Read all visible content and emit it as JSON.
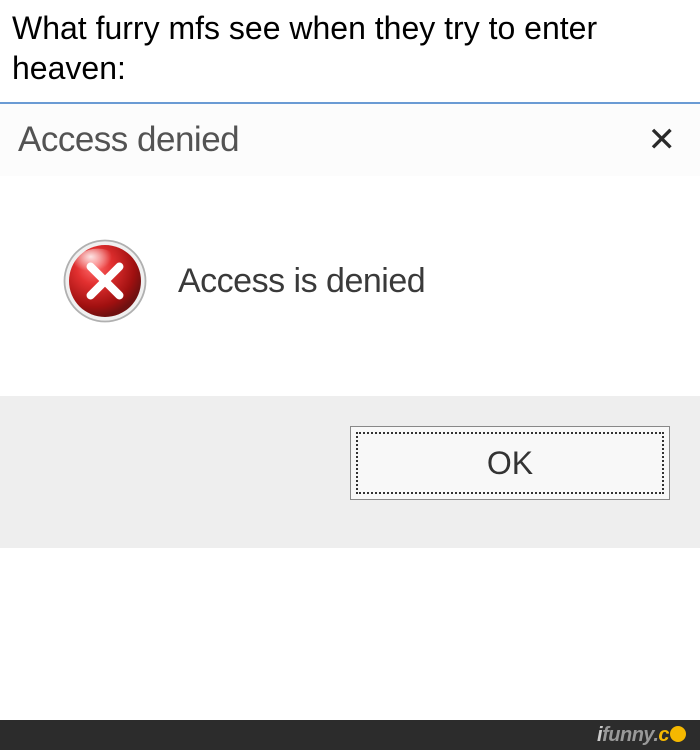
{
  "caption": "What furry mfs see when they try to enter heaven:",
  "dialog": {
    "title": "Access denied",
    "close_label": "✕",
    "message": "Access is denied",
    "ok_label": "OK"
  },
  "watermark": {
    "part1": "i",
    "part2": "funny",
    "part3": ".",
    "part4": "c"
  }
}
